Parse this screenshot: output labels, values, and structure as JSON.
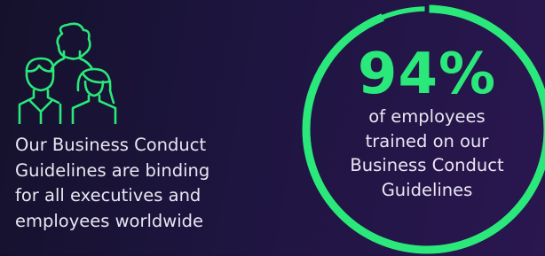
{
  "colors": {
    "accent": "#2ae87a",
    "text": "#e9e6f2",
    "background": "#1e1540"
  },
  "icon": "people-group-icon",
  "description": "Our Business Conduct\nGuidelines are binding\nfor all executives and\nemployees worldwide",
  "stat": {
    "value": "94%",
    "caption": "of employees\ntrained on our\nBusiness Conduct\nGuidelines",
    "ring_fraction": 0.94
  }
}
